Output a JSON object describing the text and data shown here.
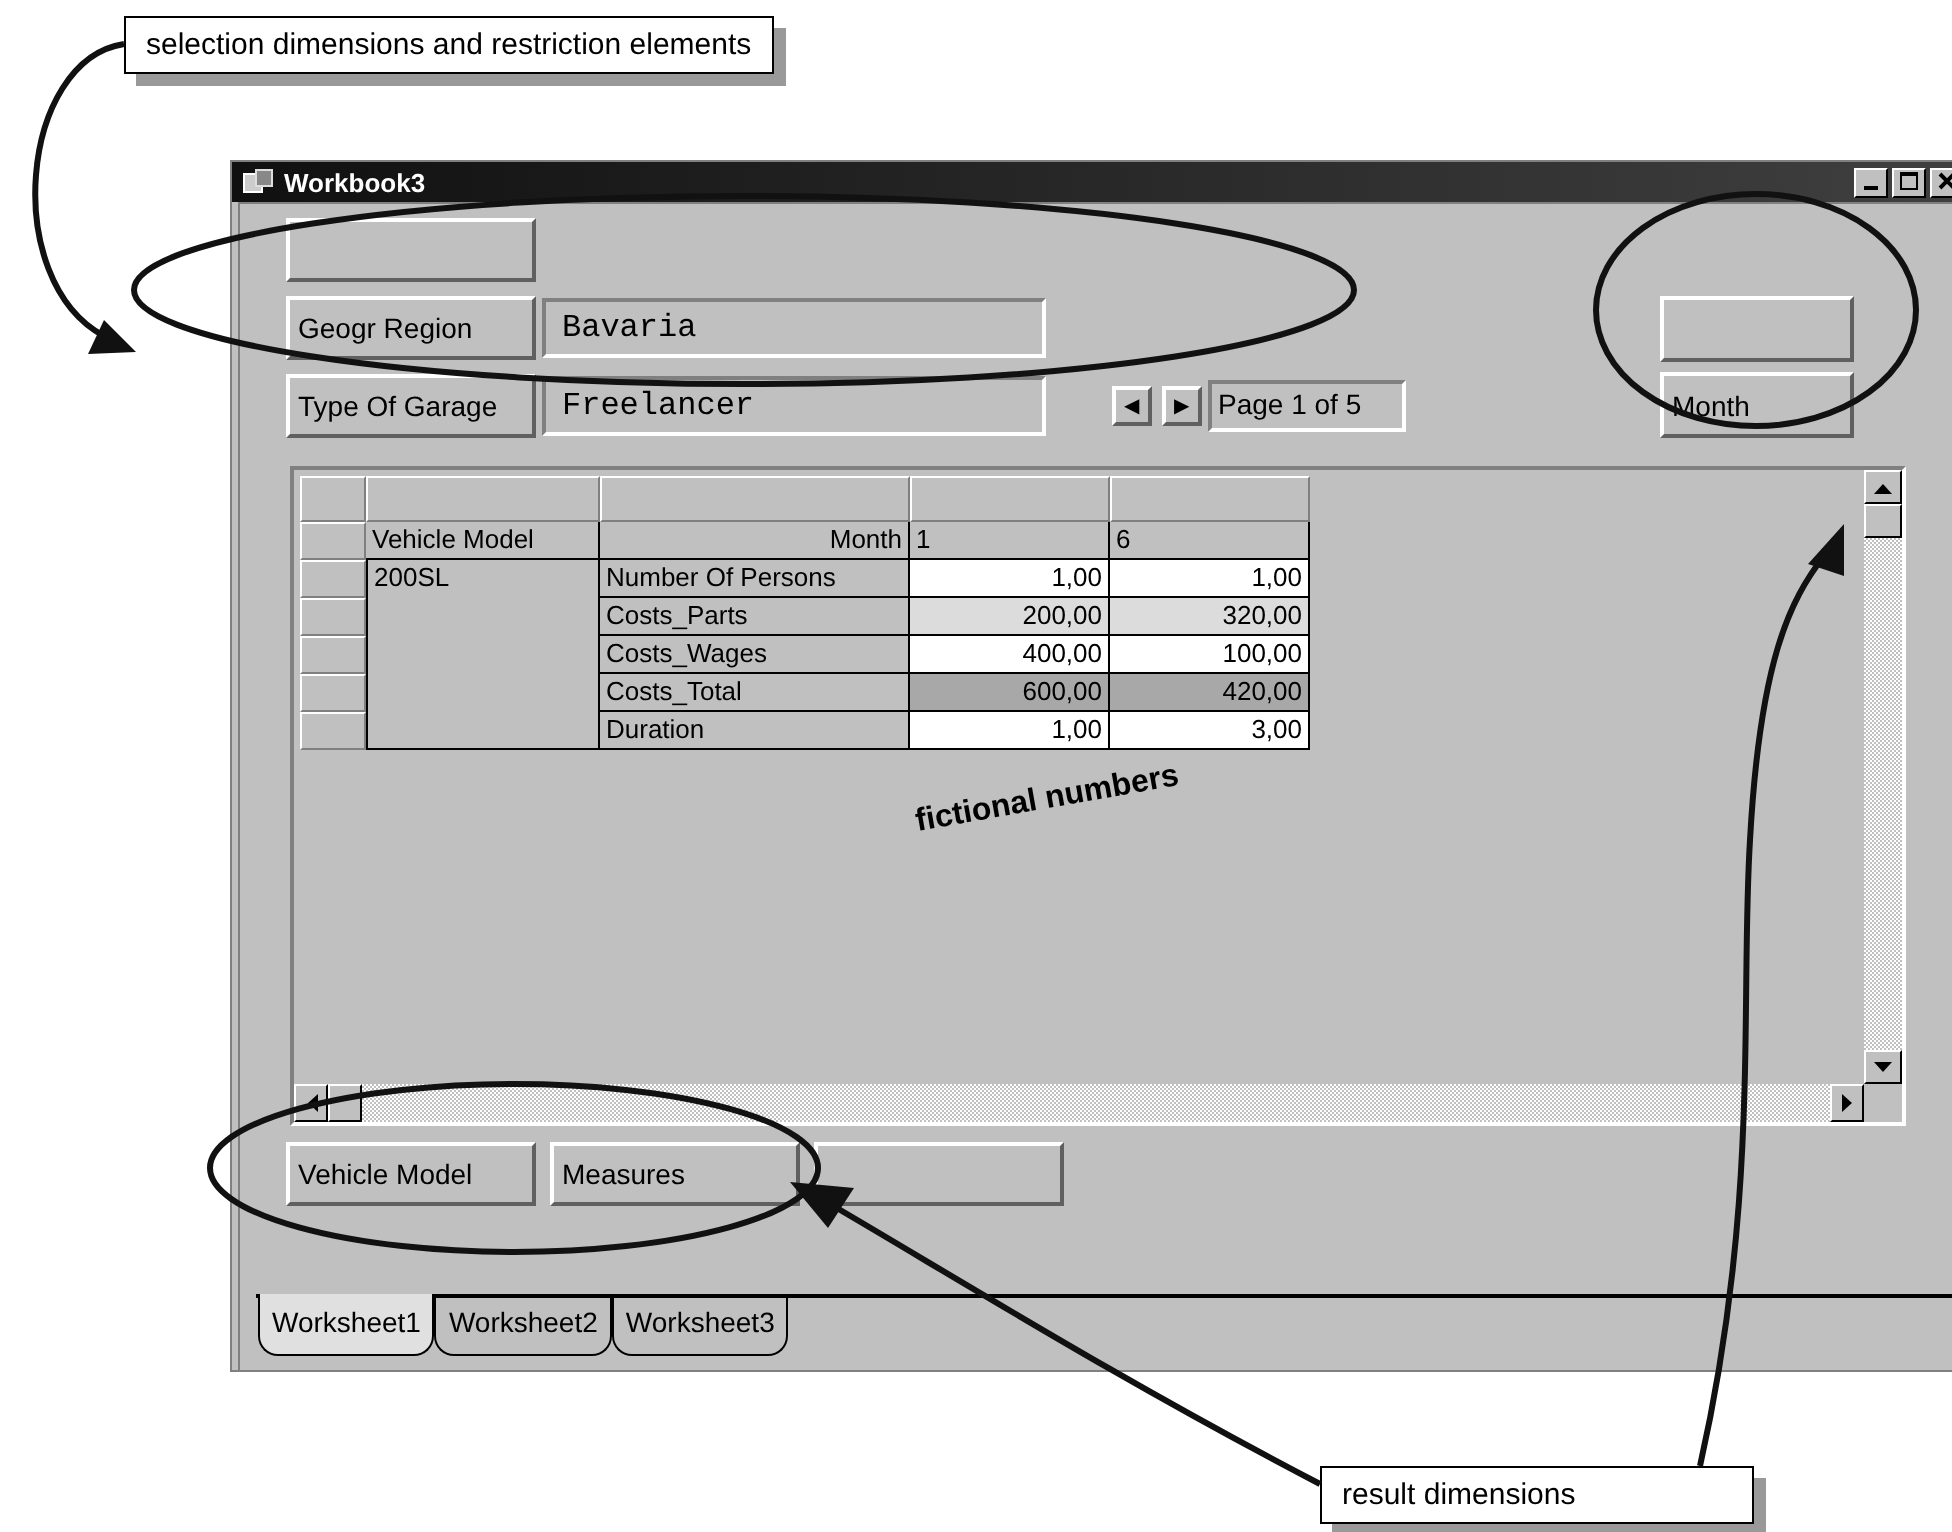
{
  "callouts": [
    {
      "text": "selection dimensions and restriction elements"
    },
    {
      "text": "result dimensions"
    }
  ],
  "window": {
    "title": "Workbook3"
  },
  "page_buttons": [
    {
      "kind": "empty"
    }
  ],
  "restrictions": [
    {
      "label": "Geogr Region",
      "value": "Bavaria"
    },
    {
      "label": "Type Of Garage",
      "value": "Freelancer"
    }
  ],
  "pager": {
    "prev": "◀",
    "next": "▶",
    "text": "Page 1 of 5"
  },
  "column_dimensions": [
    {
      "kind": "empty"
    },
    {
      "kind": "dimension",
      "label": "Month"
    }
  ],
  "table": {
    "row_dimension": "Vehicle Model",
    "column_dimension": "Month",
    "columns": [
      "1",
      "6"
    ],
    "member": "200SL",
    "rows": [
      {
        "measure": "Number Of Persons",
        "kind": "plain",
        "values": [
          "1,00",
          "1,00"
        ]
      },
      {
        "measure": "Costs_Parts",
        "kind": "tinted",
        "values": [
          "200,00",
          "320,00"
        ]
      },
      {
        "measure": "Costs_Wages",
        "kind": "plain",
        "values": [
          "400,00",
          "100,00"
        ]
      },
      {
        "measure": "Costs_Total",
        "kind": "shaded",
        "values": [
          "600,00",
          "420,00"
        ]
      },
      {
        "measure": "Duration",
        "kind": "plain",
        "values": [
          "1,00",
          "3,00"
        ]
      }
    ]
  },
  "overlay": "fictional numbers",
  "row_dimensions": [
    {
      "kind": "dimension",
      "label": "Vehicle Model"
    },
    {
      "kind": "dimension",
      "label": "Measures"
    },
    {
      "kind": "empty"
    }
  ],
  "tabs": [
    {
      "label": "Worksheet1",
      "selected": true
    },
    {
      "label": "Worksheet2",
      "selected": false
    },
    {
      "label": "Worksheet3",
      "selected": false
    }
  ]
}
